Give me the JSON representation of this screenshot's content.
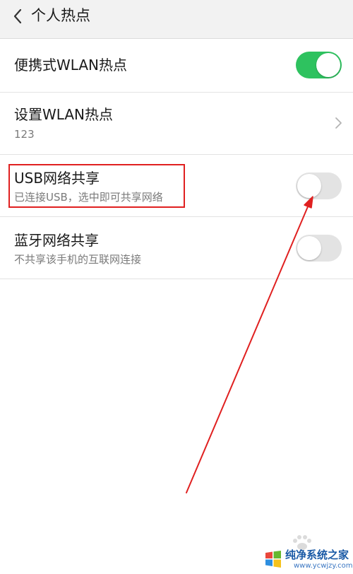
{
  "header": {
    "title": "个人热点",
    "back_icon": "chevron-left-icon"
  },
  "settings": [
    {
      "id": "portable-wlan-hotspot",
      "title": "便携式WLAN热点",
      "subtitle": "",
      "control": "toggle",
      "enabled": true
    },
    {
      "id": "configure-wlan-hotspot",
      "title": "设置WLAN热点",
      "subtitle": "123",
      "control": "chevron-right-icon"
    },
    {
      "id": "usb-tethering",
      "title": "USB网络共享",
      "subtitle": "已连接USB，选中即可共享网络",
      "control": "toggle",
      "enabled": false
    },
    {
      "id": "bluetooth-tethering",
      "title": "蓝牙网络共享",
      "subtitle": "不共享该手机的互联网连接",
      "control": "toggle",
      "enabled": false
    }
  ],
  "annotations": {
    "highlight_color": "#e02020",
    "arrow_color": "#e02020",
    "highlighted_item": "USB网络共享"
  },
  "colors": {
    "toggle_on": "#2ec25f",
    "toggle_off": "#e3e3e3",
    "header_bg": "#f2f2f2"
  },
  "watermark": {
    "title": "纯净系统之家",
    "url": "www.ycwjzy.com",
    "logo_icon": "windows-logo-icon"
  }
}
